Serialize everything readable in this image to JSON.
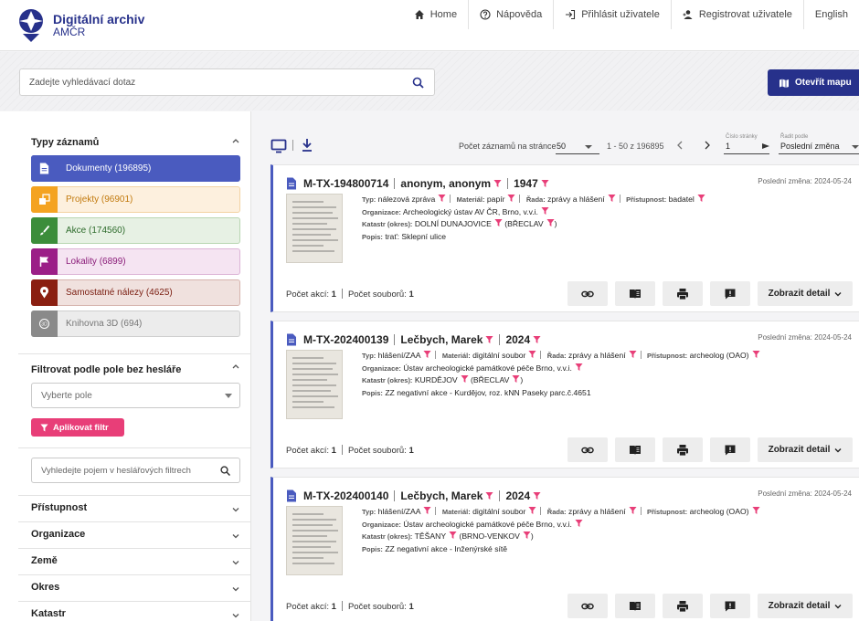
{
  "header": {
    "brand_title": "Digitální archiv",
    "brand_subtitle": "AMČR",
    "nav": [
      "Home",
      "Nápověda",
      "Přihlásit uživatele",
      "Registrovat uživatele",
      "English"
    ]
  },
  "search": {
    "placeholder": "Zadejte vyhledávací dotaz",
    "value": "",
    "map_button": "Otevřít mapu"
  },
  "sidebar": {
    "types_heading": "Typy záznamů",
    "types": [
      {
        "label": "Dokumenty",
        "count": "(196895)",
        "icon": "document-icon",
        "color": "#4a5bbf",
        "active": true
      },
      {
        "label": "Projekty",
        "count": "(96901)",
        "icon": "projects-icon",
        "color": "#f4a321",
        "active": false
      },
      {
        "label": "Akce",
        "count": "(174560)",
        "icon": "brush-icon",
        "color": "#3c8d3a",
        "active": false
      },
      {
        "label": "Lokality",
        "count": "(6899)",
        "icon": "flag-icon",
        "color": "#9b1f87",
        "active": false
      },
      {
        "label": "Samostatné nálezy",
        "count": "(4625)",
        "icon": "pin-icon",
        "color": "#8a1f11",
        "active": false
      },
      {
        "label": "Knihovna 3D",
        "count": "(694)",
        "icon": "3d-icon",
        "color": "#8a8a8a",
        "active": false
      }
    ],
    "filter_heading": "Filtrovat podle pole bez hesláře",
    "select_placeholder": "Vyberte pole",
    "apply_button": "Aplikovat filtr",
    "filter_search_placeholder": "Vyhledejte pojem v heslářových filtrech",
    "accordions": [
      "Přístupnost",
      "Organizace",
      "Země",
      "Okres",
      "Katastr"
    ]
  },
  "toolbar": {
    "per_page_label": "Počet záznamů na stránce",
    "per_page_value": "50",
    "range": "1 - 50 z 196895",
    "page_label": "Číslo stránky",
    "page_value": "1",
    "sort_label": "Řadit podle",
    "sort_value": "Poslední změna"
  },
  "labels": {
    "typ": "Typ:",
    "material": "Materiál:",
    "rada": "Řada:",
    "pristupnost": "Přístupnost:",
    "organizace": "Organizace:",
    "katastr": "Katastr (okres):",
    "popis": "Popis:",
    "pocet_akci": "Počet akcí:",
    "pocet_souboru": "Počet souborů:",
    "detail": "Zobrazit detail"
  },
  "records": [
    {
      "id": "M-TX-194800714",
      "author": "anonym, anonym",
      "year": "1947",
      "changed": "Poslední změna: 2024-05-24",
      "typ": "nálezová zpráva",
      "material": "papír",
      "rada": "zprávy a hlášení",
      "pristupnost": "badatel",
      "organizace": "Archeologický ústav AV ČR, Brno, v.v.i.",
      "katastr": "DOLNÍ DUNAJOVICE",
      "okres": "BŘECLAV",
      "popis": "trať: Sklepní ulice",
      "akci": "1",
      "souboru": "1"
    },
    {
      "id": "M-TX-202400139",
      "author": "Lečbych, Marek",
      "year": "2024",
      "changed": "Poslední změna: 2024-05-24",
      "typ": "hlášení/ZAA",
      "material": "digitální soubor",
      "rada": "zprávy a hlášení",
      "pristupnost": "archeolog (OAO)",
      "organizace": "Ústav archeologické památkové péče Brno, v.v.i.",
      "katastr": "KURDĚJOV",
      "okres": "BŘECLAV",
      "popis": "ZZ negativní akce - Kurdějov, roz. kNN Paseky parc.č.4651",
      "akci": "1",
      "souboru": "1"
    },
    {
      "id": "M-TX-202400140",
      "author": "Lečbych, Marek",
      "year": "2024",
      "changed": "Poslední změna: 2024-05-24",
      "typ": "hlášení/ZAA",
      "material": "digitální soubor",
      "rada": "zprávy a hlášení",
      "pristupnost": "archeolog (OAO)",
      "organizace": "Ústav archeologické památkové péče Brno, v.v.i.",
      "katastr": "TĚŠANY",
      "okres": "BRNO-VENKOV",
      "popis": "ZZ negativní akce - Inženýrské sítě",
      "akci": "1",
      "souboru": "1"
    }
  ],
  "colors": {
    "primary": "#27318b",
    "accent": "#e83e78",
    "card_border": "#4a5bbf"
  }
}
